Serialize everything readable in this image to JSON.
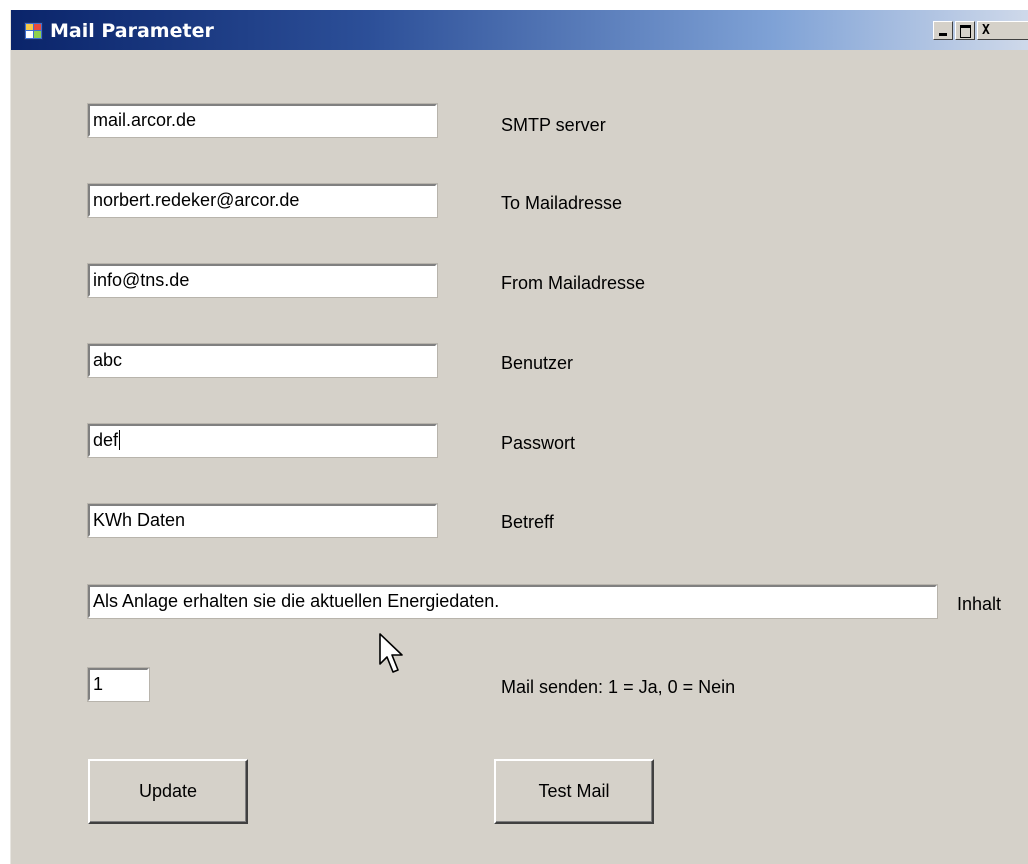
{
  "window": {
    "title": "Mail Parameter",
    "close_glyph": "X"
  },
  "fields": {
    "smtp_server": {
      "value": "mail.arcor.de",
      "label": "SMTP server"
    },
    "to_address": {
      "value": "norbert.redeker@arcor.de",
      "label": "To Mailadresse"
    },
    "from_address": {
      "value": "info@tns.de",
      "label": "From Mailadresse"
    },
    "user": {
      "value": "abc",
      "label": "Benutzer"
    },
    "password": {
      "value": "def",
      "label": "Passwort"
    },
    "subject": {
      "value": "KWh Daten",
      "label": "Betreff"
    },
    "content": {
      "value": "Als Anlage erhalten sie die aktuellen Energiedaten.",
      "label": "Inhalt"
    },
    "send_mail": {
      "value": "1",
      "label": "Mail senden: 1 = Ja, 0 = Nein"
    }
  },
  "buttons": {
    "update": "Update",
    "test_mail": "Test Mail"
  },
  "colors": {
    "window_bg": "#d5d1c9",
    "titlebar_start": "#0a246a",
    "titlebar_end": "#cfd9ea"
  },
  "icons": {
    "app": "app-form-icon",
    "minimize": "minimize-icon",
    "maximize": "maximize-icon",
    "close": "close-icon",
    "cursor": "mouse-pointer-icon"
  }
}
